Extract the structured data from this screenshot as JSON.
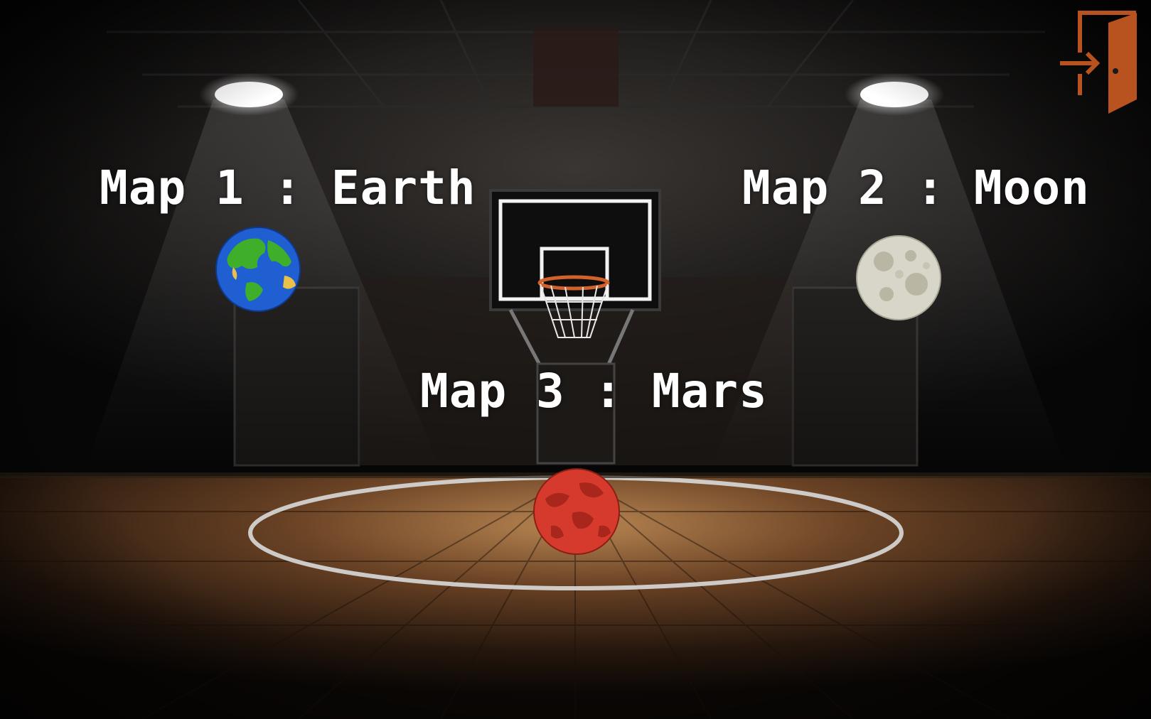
{
  "maps": [
    {
      "label": "Map 1 : Earth",
      "icon": "earth-icon"
    },
    {
      "label": "Map 2 : Moon",
      "icon": "moon-icon"
    },
    {
      "label": "Map 3 : Mars",
      "icon": "mars-icon"
    }
  ],
  "exit": {
    "icon": "exit-door-icon"
  },
  "colors": {
    "title_text": "#ffffff",
    "exit_icon": "#b8521e",
    "earth_ocean": "#1f5fd1",
    "earth_land": "#3fae2a",
    "moon": "#d8d6c8",
    "mars": "#d63a2c"
  }
}
